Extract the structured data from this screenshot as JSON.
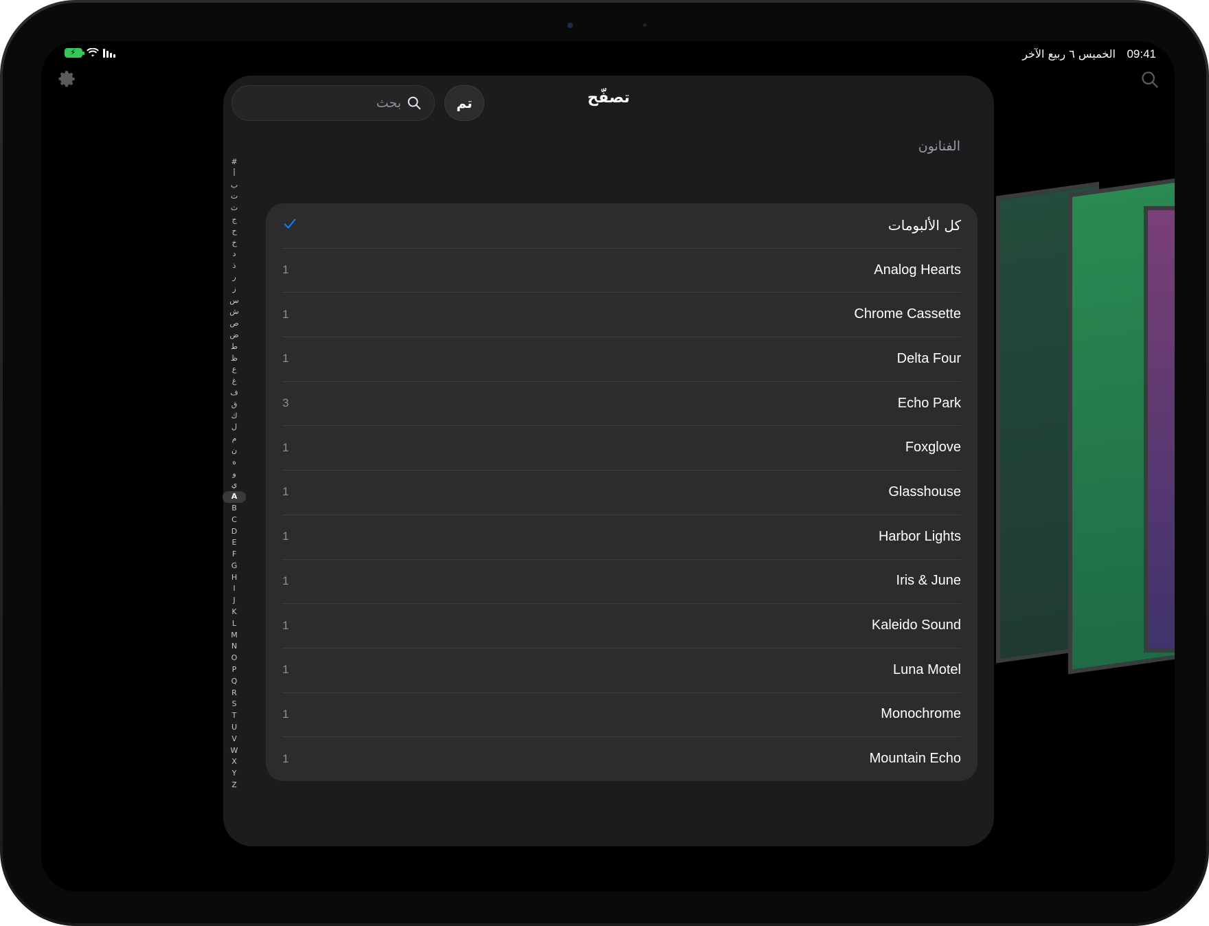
{
  "status_bar": {
    "time": "09:41",
    "date": "الخميس ٦ ربيع الآخر"
  },
  "sheet": {
    "title": "تصفّح",
    "done_label": "تم",
    "search_placeholder": "بحث",
    "section_header": "الفنانون"
  },
  "index_letters": [
    "#",
    "أ",
    "ب",
    "ت",
    "ث",
    "ج",
    "ح",
    "خ",
    "د",
    "ذ",
    "ر",
    "ز",
    "س",
    "ش",
    "ص",
    "ض",
    "ط",
    "ظ",
    "ع",
    "غ",
    "ف",
    "ق",
    "ك",
    "ل",
    "م",
    "ن",
    "ه",
    "و",
    "ي",
    "A",
    "B",
    "C",
    "D",
    "E",
    "F",
    "G",
    "H",
    "I",
    "J",
    "K",
    "L",
    "M",
    "N",
    "O",
    "P",
    "Q",
    "R",
    "S",
    "T",
    "U",
    "V",
    "W",
    "X",
    "Y",
    "Z"
  ],
  "index_selected": "A",
  "artists": [
    {
      "name": "كل الألبومات",
      "count": "",
      "selected": true
    },
    {
      "name": "Analog Hearts",
      "count": "1"
    },
    {
      "name": "Chrome Cassette",
      "count": "1"
    },
    {
      "name": "Delta Four",
      "count": "1"
    },
    {
      "name": "Echo Park",
      "count": "3"
    },
    {
      "name": "Foxglove",
      "count": "1"
    },
    {
      "name": "Glasshouse",
      "count": "1"
    },
    {
      "name": "Harbor Lights",
      "count": "1"
    },
    {
      "name": "Iris & June",
      "count": "1"
    },
    {
      "name": "Kaleido Sound",
      "count": "1"
    },
    {
      "name": "Luna Motel",
      "count": "1"
    },
    {
      "name": "Monochrome",
      "count": "1"
    },
    {
      "name": "Mountain Echo",
      "count": "1"
    }
  ],
  "colors": {
    "accent": "#0a84ff",
    "sheet_bg": "#1c1c1e",
    "list_bg": "#2c2c2e",
    "battery": "#34c759"
  },
  "icons": {
    "settings": "gear-icon",
    "search": "search-icon",
    "check": "checkmark-icon"
  }
}
